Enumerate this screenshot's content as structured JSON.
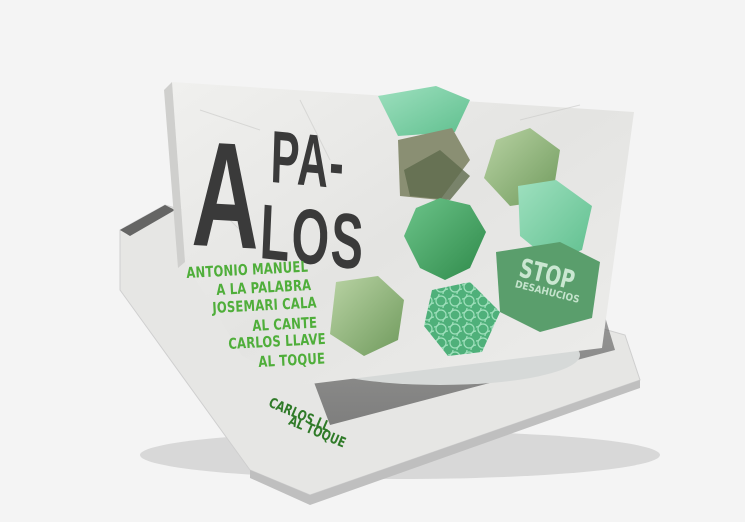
{
  "cover": {
    "title_line1_a": "A",
    "title_line1_pa": "PA-",
    "title_line2_los": "LOS",
    "credits": [
      "ANTONIO MANUEL",
      "A LA PALABRA",
      "JOSEMARI CALA",
      "AL CANTE",
      "CARLOS LLAVE",
      "AL TOQUE"
    ],
    "sign_text_1": "STOP",
    "sign_text_2": "DESAHUCIOS"
  },
  "back_case": {
    "credits": [
      "CARLOS LL",
      "AL TOQUE"
    ]
  },
  "colors": {
    "background": "#f4f4f4",
    "title": "#3a3a3a",
    "credit_green": "#4fae3a",
    "tile_green_light": "#7fcfa6",
    "tile_green_dark": "#2f8a4a"
  }
}
